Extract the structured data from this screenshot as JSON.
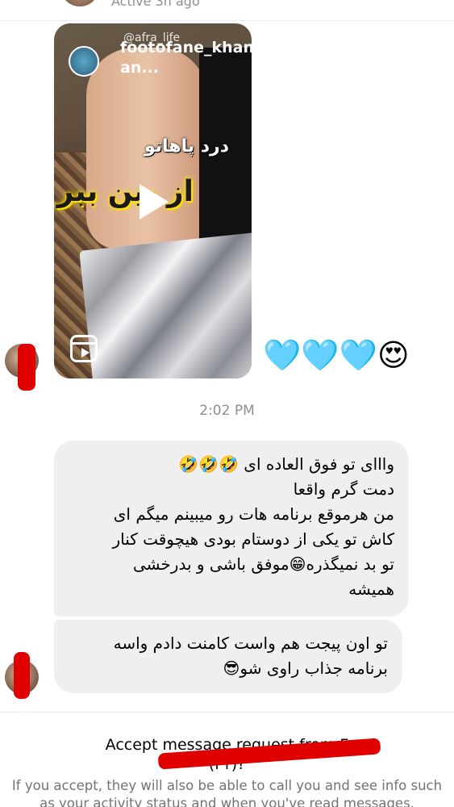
{
  "header": {
    "status": "Active 3h ago"
  },
  "shared_reel": {
    "handle_overlay": "@afra_life",
    "username": "footofane_khanedari an...",
    "caption_line1": "درد پاهاتو",
    "caption_line2": "از بین ببر"
  },
  "reaction": {
    "emojis": "🩵🩵🩵😍"
  },
  "timestamp": "2:02 PM",
  "messages": [
    {
      "lines": [
        "وااای تو فوق العاده ای 🤣🤣🤣",
        "دمت گرم واقعا",
        "من هرموقع برنامه هات رو میبینم میگم ای",
        "کاش تو یکی از دوستام بودی هیچوقت کنار",
        "تو بد نمیگذره😁موفق باشی و بدرخشی",
        "همیشه"
      ]
    },
    {
      "lines": [
        "تو اون پیجت هم واست کامنت دادم واسه",
        "برنامه جذاب راوی شو😎"
      ]
    }
  ],
  "request": {
    "title": "Accept message request from F",
    "name_line": "(f                    r)?",
    "body": "If you accept, they will also be able to call you and see info such as your activity status and when you've read messages."
  },
  "colors": {
    "bubble": "#efefef",
    "secondary_text": "#8e8e8e",
    "redaction": "#e00000"
  }
}
